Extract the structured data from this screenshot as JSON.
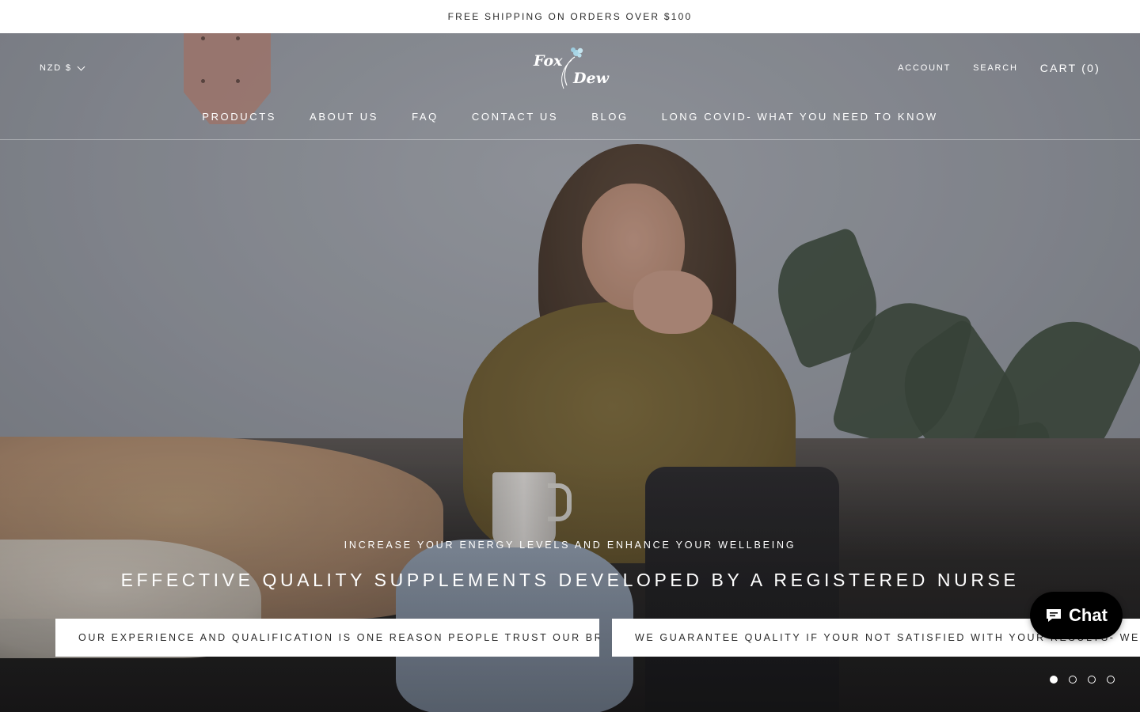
{
  "announcement": {
    "text": "FREE SHIPPING ON ORDERS OVER $100"
  },
  "header": {
    "currency": "NZD $",
    "logo": {
      "line1": "Fox",
      "line2": "Dew"
    },
    "account": "ACCOUNT",
    "search": "SEARCH",
    "cart": "CART (0)"
  },
  "nav": {
    "items": [
      {
        "label": "PRODUCTS"
      },
      {
        "label": "ABOUT US"
      },
      {
        "label": "FAQ"
      },
      {
        "label": "CONTACT US"
      },
      {
        "label": "BLOG"
      },
      {
        "label": "LONG COVID- WHAT YOU NEED TO KNOW"
      }
    ]
  },
  "hero": {
    "subheading": "INCREASE YOUR ENERGY LEVELS AND ENHANCE YOUR WELLBEING",
    "headline": "EFFECTIVE QUALITY SUPPLEMENTS DEVELOPED BY A REGISTERED NURSE",
    "buttons": [
      {
        "label": "OUR EXPERIENCE AND QUALIFICATION IS ONE REASON PEOPLE TRUST OUR BRAND"
      },
      {
        "label": "WE GUARANTEE QUALITY IF YOUR NOT SATISFIED WITH YOUR RESULTS- WE REFUND"
      }
    ],
    "slides": {
      "total": 4,
      "active": 1
    }
  },
  "chat": {
    "label": "Chat"
  },
  "colors": {
    "overlay": "#1e1e23",
    "chat_bg": "#000000",
    "text_on_hero": "#ffffff"
  },
  "icons": [
    "chevron-down-icon",
    "logo-flower-icon",
    "chat-bubble-icon"
  ]
}
